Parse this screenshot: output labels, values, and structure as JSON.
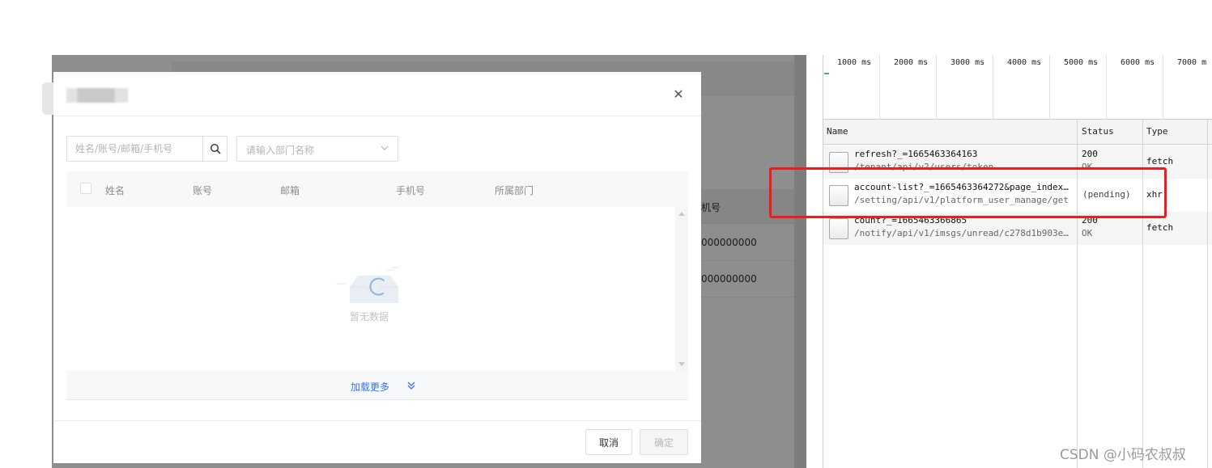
{
  "app_background": {
    "column_header": "机号",
    "rows": [
      "000000000",
      "000000000"
    ]
  },
  "modal": {
    "search": {
      "placeholder": "姓名/账号/邮箱/手机号"
    },
    "department_select": {
      "placeholder": "请输入部门名称"
    },
    "table": {
      "columns": [
        "姓名",
        "账号",
        "邮箱",
        "手机号",
        "所属部门"
      ],
      "empty_text": "暂无数据"
    },
    "load_more_label": "加载更多",
    "cancel_label": "取消",
    "confirm_label": "确定"
  },
  "devtools": {
    "timeline_ticks": [
      "1000 ms",
      "2000 ms",
      "3000 ms",
      "4000 ms",
      "5000 ms",
      "6000 ms",
      "7000 m"
    ],
    "columns": {
      "name": "Name",
      "status": "Status",
      "type": "Type"
    },
    "requests": [
      {
        "name": "refresh?_=1665463364163",
        "path": "/tenant/api/v2/users/token",
        "status": "200",
        "status_text": "OK",
        "type": "fetch",
        "extra": ""
      },
      {
        "name": "account-list?_=1665463364272&page_index…",
        "path": "/setting/api/v1/platform_user_manage/get",
        "status": "(pending)",
        "status_text": "",
        "type": "xhr",
        "extra": ""
      },
      {
        "name": "count?_=1665463366865",
        "path": "/notify/api/v1/imsgs/unread/c278d1b903e…",
        "status": "200",
        "status_text": "OK",
        "type": "fetch",
        "extra": ""
      }
    ]
  },
  "watermark": "CSDN @小码农叔叔",
  "colors": {
    "accent": "#3370ff",
    "highlight_box": "#f21b1b",
    "overlay": "#8e8e8e"
  }
}
